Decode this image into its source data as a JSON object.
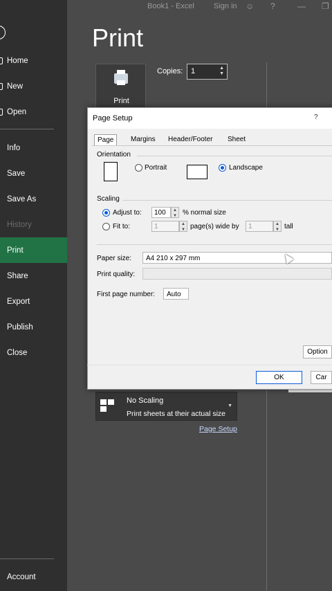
{
  "topbar": {
    "book_title": "Book1  -  Excel",
    "sign_in": "Sign in",
    "help": "?"
  },
  "sidebar": {
    "items": [
      {
        "label": "Home"
      },
      {
        "label": "New"
      },
      {
        "label": "Open"
      },
      {
        "label": "Info"
      },
      {
        "label": "Save"
      },
      {
        "label": "Save As"
      },
      {
        "label": "History"
      },
      {
        "label": "Print"
      },
      {
        "label": "Share"
      },
      {
        "label": "Export"
      },
      {
        "label": "Publish"
      },
      {
        "label": "Close"
      }
    ],
    "account": "Account"
  },
  "print": {
    "title": "Print",
    "print_button": "Print",
    "copies_label": "Copies:",
    "copies_value": "1",
    "scaling_title": "No Scaling",
    "scaling_subtitle": "Print sheets at their actual size",
    "page_setup_link": "Page Setup"
  },
  "dialog": {
    "title": "Page Setup",
    "help": "?",
    "tabs": [
      "Page",
      "Margins",
      "Header/Footer",
      "Sheet"
    ],
    "orientation_label": "Orientation",
    "portrait_label": "Portrait",
    "landscape_label": "Landscape",
    "orientation_selected": "Landscape",
    "scaling_label": "Scaling",
    "adjust_to_label": "Adjust to:",
    "adjust_to_value": "100",
    "normal_size_label": "% normal size",
    "fit_to_label": "Fit to:",
    "fit_wide_value": "1",
    "pages_wide_label": "page(s) wide by",
    "fit_tall_value": "1",
    "tall_label": "tall",
    "paper_size_label": "Paper size:",
    "paper_size_value": "A4 210 x 297 mm",
    "print_quality_label": "Print quality:",
    "first_page_label": "First page number:",
    "first_page_value": "Auto",
    "options_button": "Option",
    "ok_button": "OK",
    "cancel_button": "Car"
  },
  "colors": {
    "accent": "#217346",
    "dialog_accent": "#0a5bd6"
  }
}
